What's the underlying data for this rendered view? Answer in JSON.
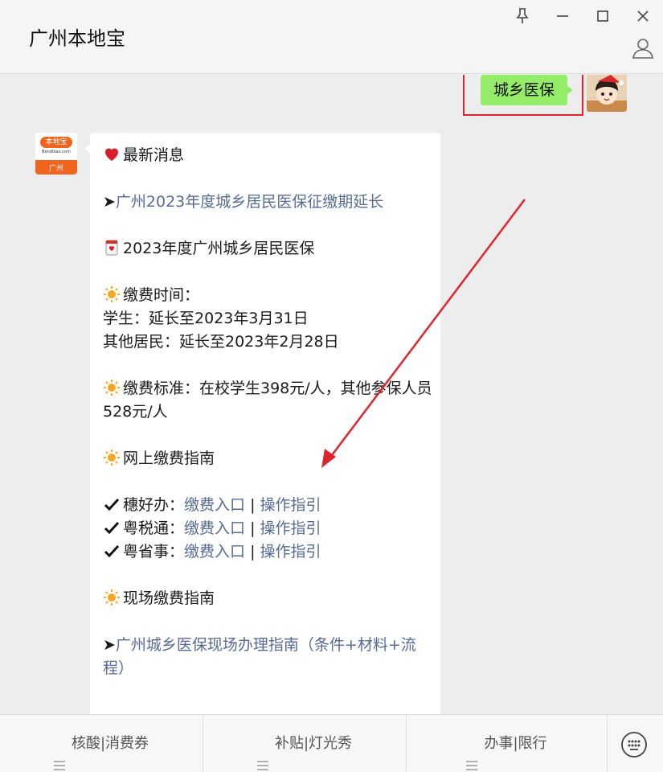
{
  "window": {
    "title": "广州本地宝"
  },
  "outgoing": {
    "text": "城乡医保"
  },
  "bot": {
    "avatar_line1": "本地宝",
    "avatar_line2": "Bendibao.com",
    "avatar_line3": "广州"
  },
  "message": {
    "heading": "最新消息",
    "news_prefix": "➤",
    "news_link": "广州2023年度城乡居民医保征缴期延长",
    "section1_title": "2023年度广州城乡居民医保",
    "pay_time_label": "缴费时间：",
    "student_time": "学生：延长至2023年3月31日",
    "other_time": "其他居民：延长至2023年2月28日",
    "standard": "缴费标准：在校学生398元/人，其他参保人员528元/人",
    "online_guide": "网上缴费指南",
    "channels": [
      {
        "name": "穗好办：",
        "entry": "缴费入口",
        "sep": " | ",
        "guide": "操作指引"
      },
      {
        "name": "粤税通：",
        "entry": "缴费入口",
        "sep": " | ",
        "guide": "操作指引"
      },
      {
        "name": "粤省事：",
        "entry": "缴费入口",
        "sep": " | ",
        "guide": "操作指引"
      }
    ],
    "onsite_guide": "现场缴费指南",
    "onsite_prefix": "➤",
    "onsite_link": "广州城乡医保现场办理指南（条件+材料+流程）"
  },
  "menu": [
    {
      "label": "核酸|消费券"
    },
    {
      "label": "补贴|灯光秀"
    },
    {
      "label": "办事|限行"
    }
  ],
  "colors": {
    "link": "#576b95",
    "bubble_out": "#95ec69",
    "highlight_box": "#e0242d",
    "avatar_orange": "#f0641e"
  },
  "icons": [
    "pin-icon",
    "minimize-icon",
    "maximize-icon",
    "close-icon",
    "profile-icon",
    "heart-icon",
    "calendar-icon",
    "sun-icon",
    "check-icon",
    "menu-lines-icon",
    "keyboard-icon"
  ]
}
